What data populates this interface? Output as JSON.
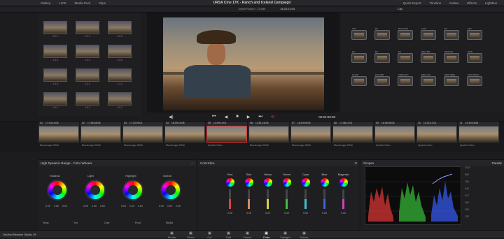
{
  "app": {
    "title": "URSA Cine 17K - Ranch and Iceland Campaign",
    "menu_left": [
      "Gallery",
      "LUTs",
      "Media Pool",
      "Clips"
    ],
    "menu_right": [
      "Quick Export",
      "Timeline",
      "Nodes",
      "Effects",
      "Lightbox"
    ]
  },
  "viewer_bar": {
    "clip_name": "Dylan Ruston - Grade",
    "timecode": "14:26:23:04",
    "clips_label": "Clip"
  },
  "gallery": {
    "stills": [
      {
        "cap": "1.2.0"
      },
      {
        "cap": "1.2.1"
      },
      {
        "cap": "1.2.2"
      },
      {
        "cap": "1.3.0"
      },
      {
        "cap": "1.3.1"
      },
      {
        "cap": "1.3.2"
      },
      {
        "cap": "1.4.0"
      },
      {
        "cap": "1.4.1"
      },
      {
        "cap": "1.4.2"
      },
      {
        "cap": "1.5.0"
      },
      {
        "cap": "1.5.1"
      },
      {
        "cap": "1.5.2"
      }
    ]
  },
  "transport": {
    "timecode": "06:52:59:08"
  },
  "nodes": [
    {
      "label": "CST"
    },
    {
      "label": "EX"
    },
    {
      "label": "BALANCE"
    },
    {
      "label": "FILM"
    },
    {
      "label": "EX"
    },
    {
      "label": "KEY"
    },
    {
      "label": "EX"
    },
    {
      "label": "EX"
    },
    {
      "label": "EX"
    },
    {
      "label": "REALME"
    },
    {
      "label": "REGION"
    },
    {
      "label": "SKIN"
    },
    {
      "label": "GLOW"
    },
    {
      "label": "EX/ DSR"
    },
    {
      "label": "CIRCLETY"
    },
    {
      "label": "EBK LOD"
    },
    {
      "label": "DEN TREE"
    },
    {
      "label": "VIGN DESC"
    }
  ],
  "timeline": {
    "clips": [
      {
        "num": "01",
        "tc": "17:43:14:08",
        "name": "Blackmagic RAW"
      },
      {
        "num": "02",
        "tc": "17:56:08:08",
        "name": "Blackmagic RAW"
      },
      {
        "num": "03",
        "tc": "17:23:09:01",
        "name": "Blackmagic RAW"
      },
      {
        "num": "04",
        "tc": "18:09:16:08",
        "name": "Blackmagic RAW"
      },
      {
        "num": "05",
        "tc": "13:49:13:01",
        "name": "Spatial Video"
      },
      {
        "num": "06",
        "tc": "13:51:16:08",
        "name": "Blackmagic RAW"
      },
      {
        "num": "07",
        "tc": "16:29:59:08",
        "name": "Blackmagic RAW"
      },
      {
        "num": "08",
        "tc": "17:48:12:01",
        "name": "Blackmagic RAW"
      },
      {
        "num": "09",
        "tc": "16:35:06:08",
        "name": "Spatial Video"
      },
      {
        "num": "10",
        "tc": "10:32:12:01",
        "name": "Spatial Video"
      },
      {
        "num": "11",
        "tc": "10:19:03:08",
        "name": "Spatial Video"
      }
    ]
  },
  "color_wheels": {
    "header": "High Dynamic Range - Color Wheels",
    "wheels": [
      {
        "name": "Shadow",
        "vals": [
          "0.00",
          "0.00",
          "0.00"
        ]
      },
      {
        "name": "Light",
        "vals": [
          "0.00",
          "0.00",
          "0.00"
        ]
      },
      {
        "name": "Highlight",
        "vals": [
          "0.00",
          "0.00",
          "0.00"
        ]
      },
      {
        "name": "Global",
        "vals": [
          "0.00",
          "0.00",
          "0.00"
        ]
      }
    ],
    "bottom_labels": [
      "Temp",
      "Tint",
      "Cont",
      "Pivot",
      "Md/Dtl"
    ]
  },
  "color_slice": {
    "header": "ColorSlice",
    "columns": [
      {
        "name": "Red",
        "color": "#e04040",
        "val": "0.00"
      },
      {
        "name": "Skin",
        "color": "#d88a60",
        "val": "0.00"
      },
      {
        "name": "Yellow",
        "color": "#e0d040",
        "val": "0.00"
      },
      {
        "name": "Green",
        "color": "#40c040",
        "val": "0.00"
      },
      {
        "name": "Cyan",
        "color": "#40c0d0",
        "val": "0.00"
      },
      {
        "name": "Blue",
        "color": "#4060e0",
        "val": "0.00"
      },
      {
        "name": "Magenta",
        "color": "#d040c0",
        "val": "0.00"
      }
    ]
  },
  "scopes": {
    "header": "Scopes",
    "parade_label": "Parade"
  },
  "bottom": {
    "product": "DaVinci Resolve Studio 19",
    "pages": [
      "Media",
      "Photo",
      "Cut",
      "Edit",
      "Fusion",
      "Color",
      "Fairlight",
      "Deliver"
    ],
    "active_page": "Color"
  }
}
